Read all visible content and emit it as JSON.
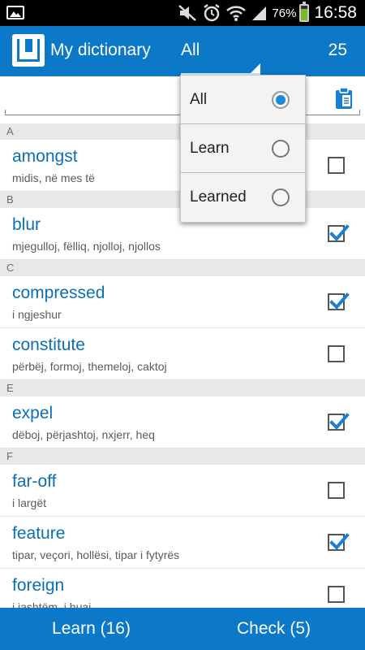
{
  "status_bar": {
    "battery_percent": "76%",
    "time": "16:58",
    "icons": [
      "image-notification-icon",
      "mute-icon",
      "alarm-icon",
      "wifi-icon",
      "signal-icon",
      "battery-icon"
    ]
  },
  "action_bar": {
    "title": "My dictionary",
    "filter_selected": "All",
    "word_count": "25"
  },
  "dropdown": {
    "options": [
      {
        "label": "All",
        "selected": true
      },
      {
        "label": "Learn",
        "selected": false
      },
      {
        "label": "Learned",
        "selected": false
      }
    ]
  },
  "list": {
    "items": [
      {
        "type": "section",
        "label": "A"
      },
      {
        "type": "entry",
        "word": "amongst",
        "translation": "midis, në mes të",
        "checked": false
      },
      {
        "type": "section",
        "label": "B"
      },
      {
        "type": "entry",
        "word": "blur",
        "translation": "mjegulloj, fëlliq, njolloj, njollos",
        "checked": true
      },
      {
        "type": "section",
        "label": "C"
      },
      {
        "type": "entry",
        "word": "compressed",
        "translation": "i ngjeshur",
        "checked": true
      },
      {
        "type": "entry",
        "word": "constitute",
        "translation": "përbëj, formoj, themeloj, caktoj",
        "checked": false
      },
      {
        "type": "section",
        "label": "E"
      },
      {
        "type": "entry",
        "word": "expel",
        "translation": "dëboj, përjashtoj, nxjerr, heq",
        "checked": true
      },
      {
        "type": "section",
        "label": "F"
      },
      {
        "type": "entry",
        "word": "far-off",
        "translation": "i largët",
        "checked": false
      },
      {
        "type": "entry",
        "word": "feature",
        "translation": "tipar, veçori, hollësi, tipar i fytyrës",
        "checked": true
      },
      {
        "type": "entry",
        "word": "foreign",
        "translation": "i jashtëm, i huaj",
        "checked": false
      }
    ]
  },
  "bottom_bar": {
    "learn_label": "Learn (16)",
    "check_label": "Check (5)"
  },
  "colors": {
    "accent": "#0b78c8",
    "word_text": "#0b6fb8",
    "check": "#1a7fd0"
  }
}
